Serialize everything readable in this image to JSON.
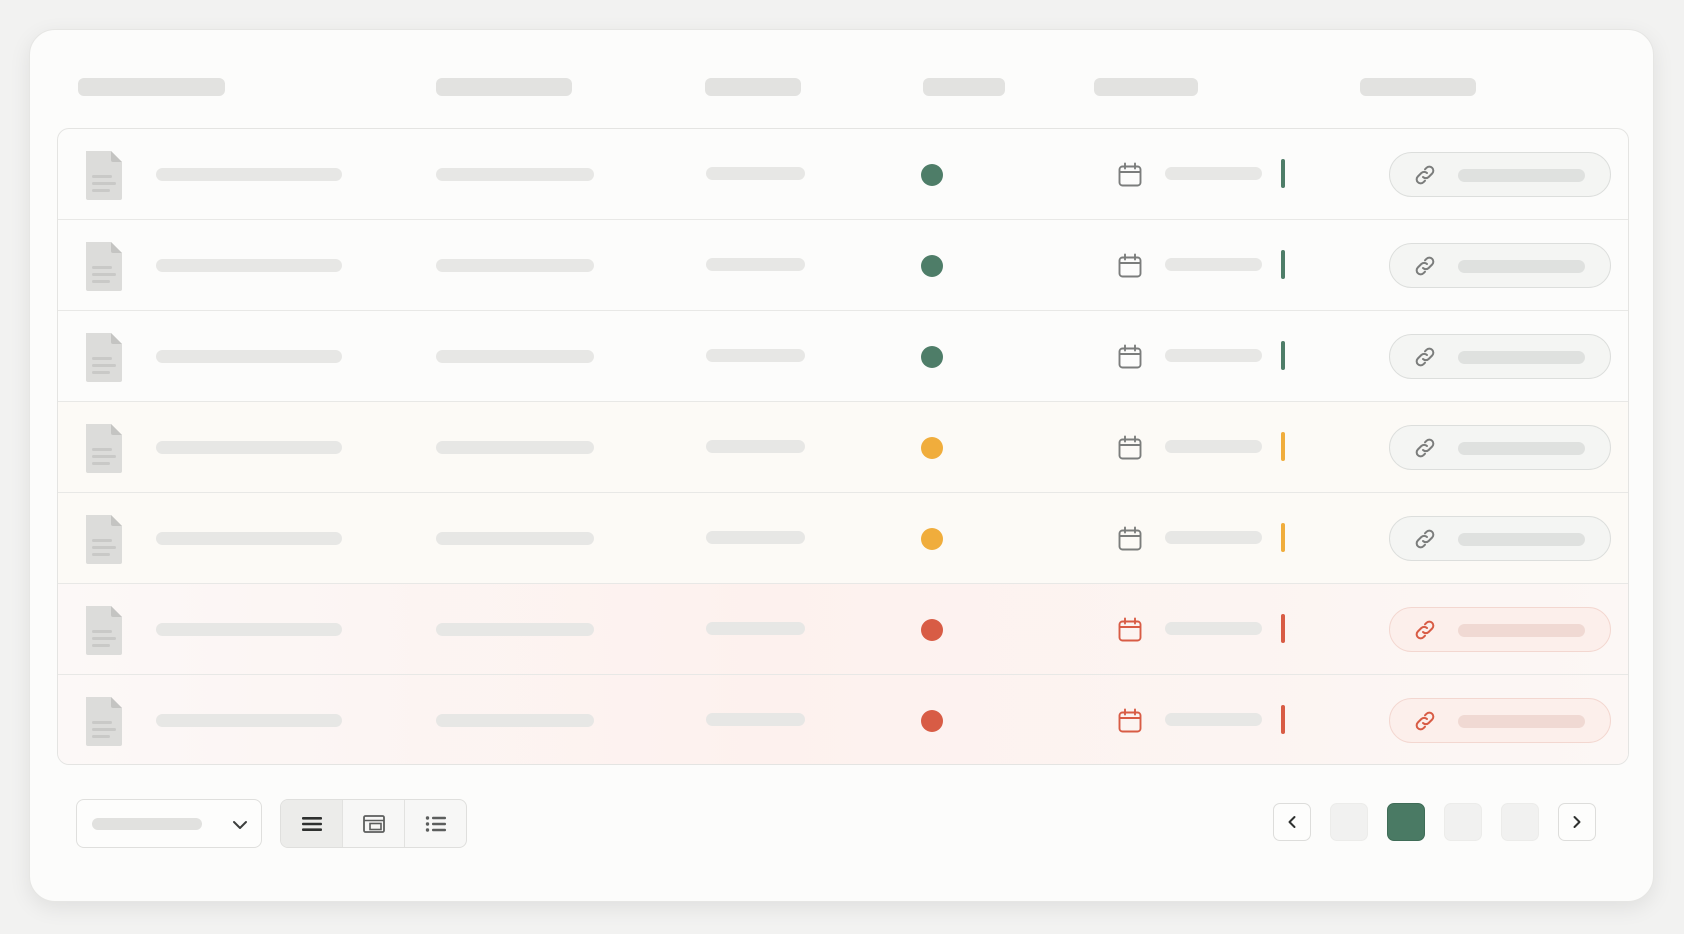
{
  "colors": {
    "success": "#4e7d68",
    "warning": "#f0ad3c",
    "danger": "#d85c45",
    "accent": "#4a7a64",
    "icon_gray": "#7b7d7c"
  },
  "table": {
    "columns": [
      "",
      "",
      "",
      "",
      "",
      ""
    ],
    "rows": [
      {
        "status": "success",
        "link_icon": "link-icon",
        "calendar_icon": "calendar-icon"
      },
      {
        "status": "success",
        "link_icon": "link-icon",
        "calendar_icon": "calendar-icon"
      },
      {
        "status": "success",
        "link_icon": "link-icon",
        "calendar_icon": "calendar-icon"
      },
      {
        "status": "warning",
        "link_icon": "link-icon",
        "calendar_icon": "calendar-icon"
      },
      {
        "status": "warning",
        "link_icon": "link-icon",
        "calendar_icon": "calendar-icon"
      },
      {
        "status": "danger",
        "link_icon": "link-icon",
        "calendar_icon": "calendar-icon"
      },
      {
        "status": "danger",
        "link_icon": "link-icon",
        "calendar_icon": "calendar-icon"
      }
    ]
  },
  "footer": {
    "page_size_select": {
      "value": ""
    },
    "view_modes": [
      {
        "icon": "list-view-icon",
        "active": true
      },
      {
        "icon": "card-view-icon",
        "active": false
      },
      {
        "icon": "bulleted-list-icon",
        "active": false
      }
    ],
    "pagination": {
      "prev_icon": "chevron-left-icon",
      "next_icon": "chevron-right-icon",
      "pages": 4,
      "current": 2
    }
  }
}
